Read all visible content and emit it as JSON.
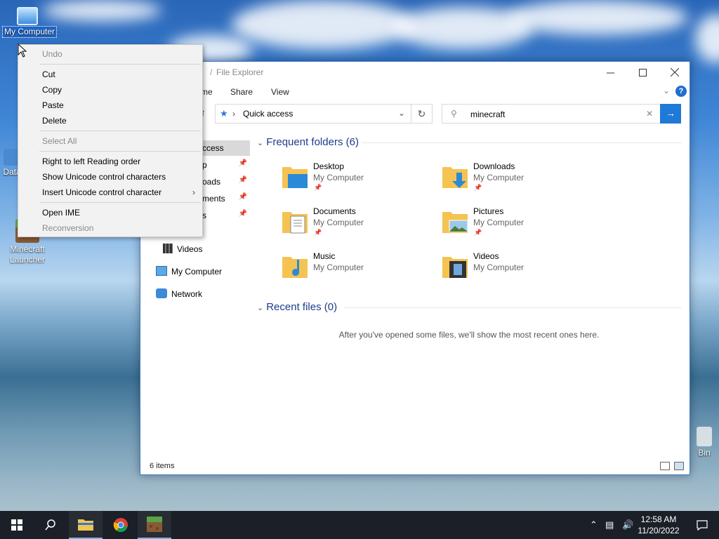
{
  "desktop": {
    "icons": [
      {
        "label": "My Computer",
        "name": "my-computer"
      },
      {
        "label": "Data",
        "name": "data"
      },
      {
        "label": "Minecraft Launcher",
        "name": "minecraft-launcher"
      },
      {
        "label": "Bin",
        "name": "recycle-bin"
      }
    ]
  },
  "explorer": {
    "title": "File Explorer",
    "title_partial": "/",
    "ribbon": {
      "home": "me",
      "share": "Share",
      "view": "View",
      "help": "?"
    },
    "address": {
      "location": "Quick access"
    },
    "search": {
      "value": "minecraft"
    },
    "nav": [
      {
        "label": "ccess",
        "pinned": false,
        "selected": true
      },
      {
        "label": "p",
        "pinned": true
      },
      {
        "label": "oads",
        "pinned": true
      },
      {
        "label": "ments",
        "pinned": true
      },
      {
        "label": "s",
        "pinned": true
      },
      {
        "label": "Videos",
        "pinned": false
      },
      {
        "label": "My Computer",
        "pinned": false
      },
      {
        "label": "Network",
        "pinned": false
      }
    ],
    "frequent_header": "Frequent folders (6)",
    "folders": [
      {
        "name": "Desktop",
        "location": "My Computer"
      },
      {
        "name": "Downloads",
        "location": "My Computer"
      },
      {
        "name": "Documents",
        "location": "My Computer"
      },
      {
        "name": "Pictures",
        "location": "My Computer"
      },
      {
        "name": "Music",
        "location": "My Computer"
      },
      {
        "name": "Videos",
        "location": "My Computer"
      }
    ],
    "recent_header": "Recent files (0)",
    "recent_message": "After you've opened some files, we'll show the most recent ones here.",
    "status": "6 items"
  },
  "context_menu": {
    "items": [
      {
        "label": "Undo",
        "disabled": true
      },
      {
        "label": "Cut"
      },
      {
        "label": "Copy"
      },
      {
        "label": "Paste"
      },
      {
        "label": "Delete"
      },
      {
        "label": "Select All",
        "disabled": true
      },
      {
        "label": "Right to left Reading order"
      },
      {
        "label": "Show Unicode control characters"
      },
      {
        "label": "Insert Unicode control character",
        "submenu": true
      },
      {
        "label": "Open IME"
      },
      {
        "label": "Reconversion",
        "disabled": true
      }
    ]
  },
  "taskbar": {
    "time": "12:58 AM",
    "date": "11/20/2022"
  },
  "colors": {
    "accent": "#1e7ad6",
    "taskbar": "#1b1f27",
    "section_header": "#1e3c8c"
  }
}
